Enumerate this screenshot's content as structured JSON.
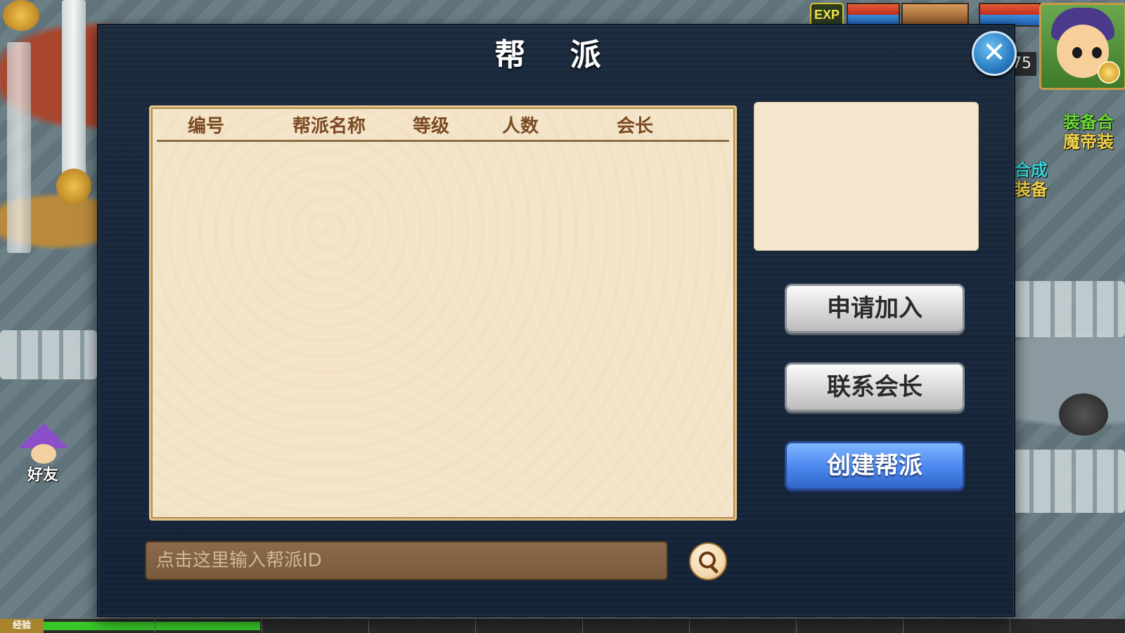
{
  "hud": {
    "exp_badge": "EXP",
    "level": "75",
    "side_texts": [
      {
        "text": "装备合",
        "color": "#6bd934"
      },
      {
        "text": "魔帝装",
        "color": "#f0d24a"
      },
      {
        "text": "合成",
        "color": "#38d4d8"
      },
      {
        "text": "装备",
        "color": "#f0d24a"
      }
    ],
    "friends_label": "好友",
    "bottom_exp_label": "经验",
    "exp_progress_fraction": 0.2
  },
  "panel": {
    "title": "帮 派",
    "close_icon": "✕",
    "columns": [
      "编号",
      "帮派名称",
      "等级",
      "人数",
      "会长"
    ],
    "rows": [],
    "buttons": {
      "apply": "申请加入",
      "contact": "联系会长",
      "create": "创建帮派"
    },
    "search": {
      "value": "",
      "placeholder": "点击这里输入帮派ID",
      "icon": "magnifier-icon"
    }
  },
  "colors": {
    "panel_bg": "#17263a",
    "list_bg": "#f4e4c9",
    "header_text": "#7a4a22",
    "create_button": "#4a86ec",
    "gray_button": "#d8d8d8"
  }
}
